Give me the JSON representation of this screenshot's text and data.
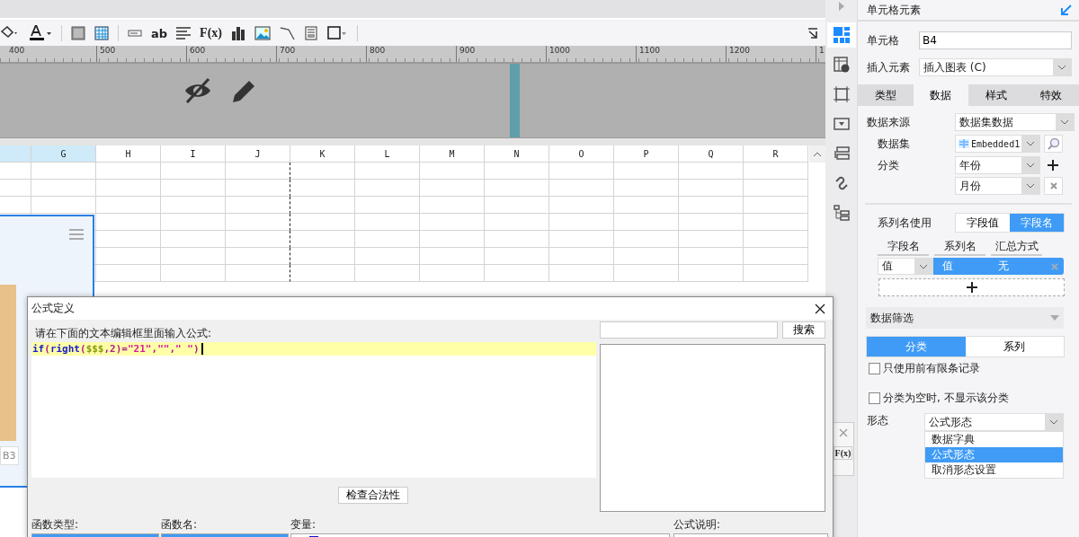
{
  "toolbar": {
    "text_buttons": [
      "ab",
      "F(x)"
    ]
  },
  "ruler": {
    "labels": [
      "400",
      "500",
      "600",
      "700",
      "800",
      "900",
      "1000",
      "1100",
      "1200",
      "1"
    ]
  },
  "sheet": {
    "columns": [
      {
        "label": "G",
        "selected": true
      },
      {
        "label": "H",
        "selected": false
      },
      {
        "label": "I",
        "selected": false
      },
      {
        "label": "J",
        "selected": false
      },
      {
        "label": "K",
        "selected": false
      },
      {
        "label": "L",
        "selected": false
      },
      {
        "label": "M",
        "selected": false
      },
      {
        "label": "N",
        "selected": false
      },
      {
        "label": "O",
        "selected": false
      },
      {
        "label": "P",
        "selected": false
      },
      {
        "label": "Q",
        "selected": false
      },
      {
        "label": "R",
        "selected": false
      }
    ],
    "cell_tab": "B3"
  },
  "dialog": {
    "title": "公式定义",
    "prompt": "请在下面的文本编辑框里面输入公式:",
    "code": [
      {
        "kind": "keyword",
        "text": "if"
      },
      {
        "kind": "punct",
        "text": "("
      },
      {
        "kind": "keyword",
        "text": "right"
      },
      {
        "kind": "punct",
        "text": "("
      },
      {
        "kind": "variable",
        "text": "$$$"
      },
      {
        "kind": "punct",
        "text": ",2)="
      },
      {
        "kind": "string",
        "text": "\"21\""
      },
      {
        "kind": "punct",
        "text": ","
      },
      {
        "kind": "string",
        "text": "\"\""
      },
      {
        "kind": "punct",
        "text": ","
      },
      {
        "kind": "string",
        "text": "\" \""
      },
      {
        "kind": "punct",
        "text": ")"
      }
    ],
    "check_button": "检查合法性",
    "search_button": "搜索",
    "labels": [
      "函数类型:",
      "函数名:",
      "变量:",
      "公式说明:"
    ]
  },
  "back_dialog": {
    "fx_button": "F(x)"
  },
  "panel": {
    "title": "单元格元素",
    "cell": {
      "label": "单元格",
      "value": "B4"
    },
    "insert": {
      "label": "插入元素",
      "value": "插入图表 (C)"
    },
    "tabs": [
      {
        "label": "类型",
        "selected": false
      },
      {
        "label": "数据",
        "selected": true
      },
      {
        "label": "样式",
        "selected": false
      },
      {
        "label": "特效",
        "selected": false
      }
    ],
    "source": {
      "label": "数据来源",
      "value": "数据集数据"
    },
    "dataset": {
      "label": "数据集",
      "value": "Embedded1"
    },
    "category": {
      "label": "分类",
      "values": [
        "年份",
        "月份"
      ]
    },
    "series_name": {
      "label": "系列名使用",
      "options": [
        {
          "label": "字段值",
          "selected": false
        },
        {
          "label": "字段名",
          "selected": true
        }
      ]
    },
    "field_table": {
      "columns": [
        "字段名",
        "系列名",
        "汇总方式"
      ],
      "rows": [
        {
          "field": "值",
          "series": "值",
          "summary": "无",
          "selected": true
        }
      ]
    },
    "filter": {
      "title": "数据筛选",
      "options": [
        {
          "label": "分类",
          "selected": true
        },
        {
          "label": "系列",
          "selected": false
        }
      ],
      "checks": [
        {
          "label": "只使用前有限条记录",
          "checked": false
        },
        {
          "label": "分类为空时, 不显示该分类",
          "checked": false
        }
      ]
    },
    "form": {
      "label": "形态",
      "value": "公式形态",
      "options": [
        {
          "label": "数据字典",
          "selected": false
        },
        {
          "label": "公式形态",
          "selected": true
        },
        {
          "label": "取消形态设置",
          "selected": false
        }
      ]
    }
  }
}
